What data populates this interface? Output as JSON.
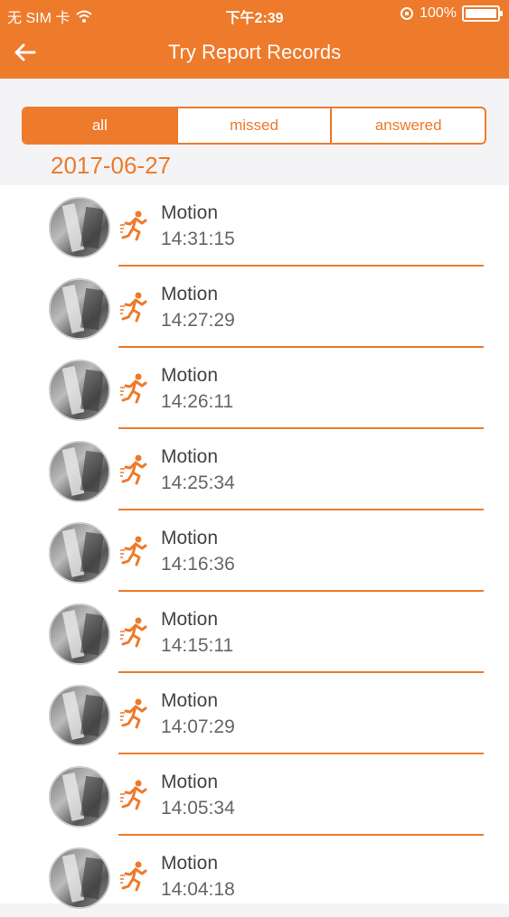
{
  "status_bar": {
    "carrier": "无 SIM 卡",
    "time": "下午2:39",
    "battery": "100%"
  },
  "nav": {
    "title": "Try Report Records"
  },
  "filters": {
    "tabs": [
      {
        "label": "all",
        "active": true
      },
      {
        "label": "missed",
        "active": false
      },
      {
        "label": "answered",
        "active": false
      }
    ]
  },
  "date_header": "2017-06-27",
  "records": [
    {
      "type": "Motion",
      "time": "14:31:15"
    },
    {
      "type": "Motion",
      "time": "14:27:29"
    },
    {
      "type": "Motion",
      "time": "14:26:11"
    },
    {
      "type": "Motion",
      "time": "14:25:34"
    },
    {
      "type": "Motion",
      "time": "14:16:36"
    },
    {
      "type": "Motion",
      "time": "14:15:11"
    },
    {
      "type": "Motion",
      "time": "14:07:29"
    },
    {
      "type": "Motion",
      "time": "14:05:34"
    },
    {
      "type": "Motion",
      "time": "14:04:18"
    }
  ],
  "colors": {
    "accent": "#ee7a2b",
    "background": "#f4f4f6"
  },
  "icons": {
    "back": "arrow-left-icon",
    "wifi": "wifi-icon",
    "lock": "rotation-lock-icon",
    "battery": "battery-icon",
    "motion": "running-person-icon"
  }
}
